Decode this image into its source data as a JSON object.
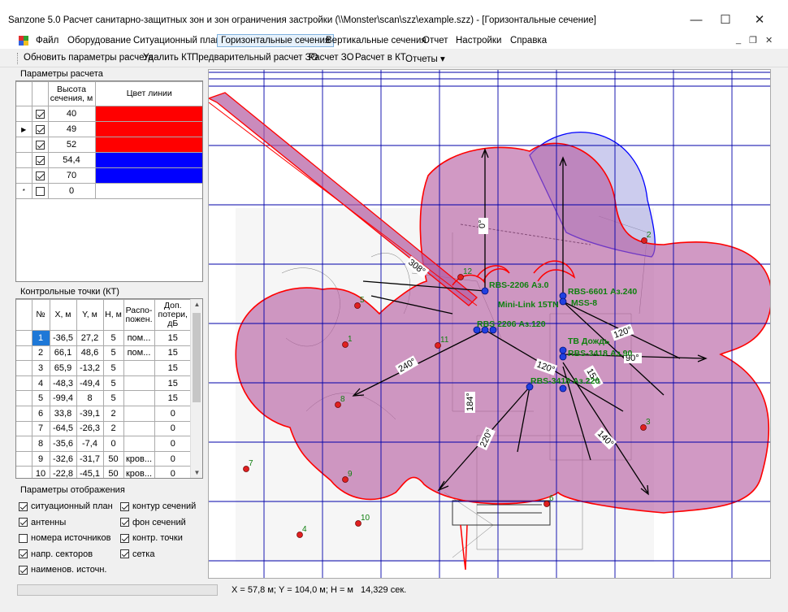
{
  "window": {
    "title": "Sanzone 5.0 Расчет санитарно-защитных зон и зон ограничения застройки (\\\\Monster\\scan\\szz\\example.szz) - [Горизонтальные сечение]",
    "minimize": "—",
    "maximize": "☐",
    "close": "✕"
  },
  "menu": {
    "items": [
      "Файл",
      "Оборудование",
      "Ситуационный план",
      "Горизонтальные сечения",
      "Вертикальные сечения",
      "Отчет",
      "Настройки",
      "Справка"
    ],
    "active_index": 3,
    "mdi_min": "_",
    "mdi_restore": "❐",
    "mdi_close": "✕"
  },
  "toolbar": {
    "items": [
      "Обновить параметры расчета",
      "Удалить КТ",
      "Предварительный расчет ЗО",
      "Расчет ЗО",
      "Расчет в КТ",
      "Отчеты ▾"
    ]
  },
  "calc_params": {
    "title": "Параметры расчета",
    "col_height": "Высота сечения, м",
    "col_color": "Цвет линии",
    "rows": [
      {
        "marker": "",
        "checked": true,
        "height": "40",
        "color": "#ff0000"
      },
      {
        "marker": "▶",
        "checked": true,
        "height": "49",
        "color": "#ff0000"
      },
      {
        "marker": "",
        "checked": true,
        "height": "52",
        "color": "#ff0000"
      },
      {
        "marker": "",
        "checked": true,
        "height": "54,4",
        "color": "#0000ff"
      },
      {
        "marker": "",
        "checked": true,
        "height": "70",
        "color": "#0000ff"
      },
      {
        "marker": "*",
        "checked": false,
        "height": "0",
        "color": "#ffffff"
      }
    ]
  },
  "control_points": {
    "title": "Контрольные точки (КТ)",
    "headers": [
      "№",
      "X, м",
      "Y, м",
      "H, м",
      "Распо-",
      "Доп. потери, дБ"
    ],
    "header_sub": "пожен.",
    "rows": [
      [
        "1",
        "-36,5",
        "27,2",
        "5",
        "пом...",
        "15"
      ],
      [
        "2",
        "66,1",
        "48,6",
        "5",
        "пом...",
        "15"
      ],
      [
        "3",
        "65,9",
        "-13,2",
        "5",
        "",
        "15"
      ],
      [
        "4",
        "-48,3",
        "-49,4",
        "5",
        "",
        "15"
      ],
      [
        "5",
        "-99,4",
        "8",
        "5",
        "",
        "15"
      ],
      [
        "6",
        "33,8",
        "-39,1",
        "2",
        "",
        "0"
      ],
      [
        "7",
        "-64,5",
        "-26,3",
        "2",
        "",
        "0"
      ],
      [
        "8",
        "-35,6",
        "-7,4",
        "0",
        "",
        "0"
      ],
      [
        "9",
        "-32,6",
        "-31,7",
        "50",
        "кров...",
        "0"
      ],
      [
        "10",
        "-22,8",
        "-45,1",
        "50",
        "кров...",
        "0"
      ]
    ]
  },
  "display_params": {
    "title": "Параметры отображения",
    "left": [
      {
        "label": "ситуационный план",
        "checked": true
      },
      {
        "label": "антенны",
        "checked": true
      },
      {
        "label": "номера источников",
        "checked": false
      },
      {
        "label": "напр. секторов",
        "checked": true
      },
      {
        "label": "наименов. источн.",
        "checked": true
      }
    ],
    "right": [
      {
        "label": "контур сечений",
        "checked": true
      },
      {
        "label": "фон сечений",
        "checked": true
      },
      {
        "label": "контр. точки",
        "checked": true
      },
      {
        "label": "сетка",
        "checked": true
      }
    ]
  },
  "map": {
    "antenna_labels": [
      "RBS-2206 Аз.0",
      "RBS-6601 Аз.240",
      "MSS-8",
      "Mini-Link 15TN",
      "RBS 2206 Аз.120",
      "ТВ Дождь",
      "RBS-3418 Аз.90",
      "RBS-3418 Аз.220"
    ],
    "azimuth_labels": [
      "0°",
      "308°",
      "240°",
      "120°",
      "90°",
      "120°",
      "157°",
      "184°",
      "220°",
      "140°"
    ],
    "kt_numbers": [
      "1",
      "2",
      "3",
      "4",
      "5",
      "6",
      "7",
      "8",
      "9",
      "10",
      "11",
      "12"
    ],
    "zone_fill": "#b45aa0",
    "zone_outline": "#ff0000",
    "zone_upper_outline": "#0000ff",
    "grid_color": "#0000aa"
  },
  "status": {
    "coords": "X = 57,8 м; Y = 104,0 м; H =  м",
    "time": "14,329 сек."
  }
}
